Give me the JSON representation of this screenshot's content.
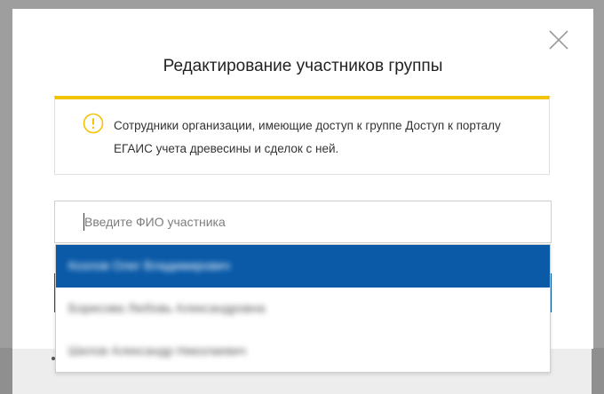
{
  "modal": {
    "title": "Редактирование участников группы",
    "close_icon": "close-icon"
  },
  "notice": {
    "icon": "warning-icon",
    "accent_color": "#f2c300",
    "text": "Сотрудники организации, имеющие доступ к группе Доступ к порталу ЕГАИС учета древесины и сделок с ней."
  },
  "search": {
    "value": "",
    "placeholder": "Введите ФИО участника"
  },
  "dropdown": {
    "selected_index": 0,
    "selected_color": "#0a5aa8",
    "options": [
      {
        "label": "Козлов Олег Владимирович"
      },
      {
        "label": "Борисова Любовь Александровна"
      },
      {
        "label": "Шилов Александр Николаевич"
      }
    ]
  }
}
